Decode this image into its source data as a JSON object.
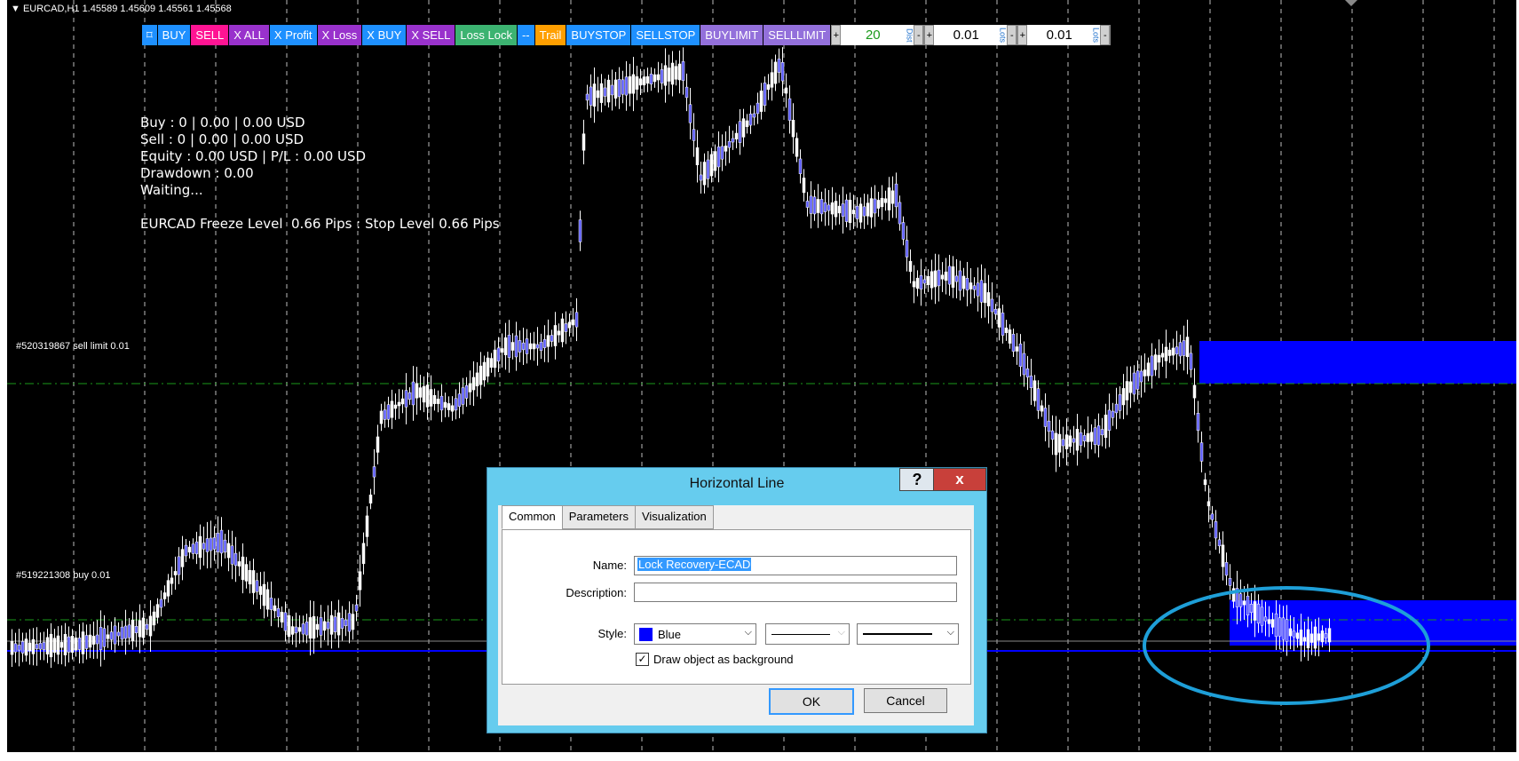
{
  "chart": {
    "header": "▼ EURCAD,H1  1.45589 1.45609 1.45561 1.45568",
    "sell_order_label": "#520319867 sell limit 0.01",
    "buy_order_label": "#519221308 buy 0.01"
  },
  "toolbar": {
    "buttons": [
      "⌑",
      "BUY",
      "SELL",
      "X ALL",
      "X Profit",
      "X Loss",
      "X BUY",
      "X SELL",
      "Loss Lock",
      "--",
      "Trail",
      "BUYSTOP",
      "SELLSTOP",
      "BUYLIMIT",
      "SELLLIMIT"
    ],
    "dist_value": "20",
    "dist_tag": "Dist",
    "lots_value_1": "0.01",
    "lots_tag_1": "Lots",
    "lots_value_2": "0.01",
    "lots_tag_2": "Lots",
    "plus": "+",
    "minus": "-"
  },
  "info": {
    "buy": "Buy : 0 | 0.00 | 0.00 USD",
    "sell": "Sell : 0 | 0.00 | 0.00 USD",
    "equity": "Equity : 0.00 USD | P/L : 0.00 USD",
    "drawdown": "Drawdown : 0.00",
    "status": "Waiting...",
    "levels": "EURCAD Freeze Level  0.66 Pips : Stop Level 0.66 Pips"
  },
  "dialog": {
    "title": "Horizontal Line",
    "help": "?",
    "close": "x",
    "tabs": [
      "Common",
      "Parameters",
      "Visualization"
    ],
    "name_label": "Name:",
    "name_value": "Lock Recovery-ECAD",
    "description_label": "Description:",
    "description_value": "",
    "style_label": "Style:",
    "color_value": "Blue",
    "draw_background_label": "Draw object as background",
    "draw_background_checked": true,
    "ok": "OK",
    "cancel": "Cancel"
  },
  "colors": {
    "chart_bg": "#000000",
    "candle": "#ffffff",
    "candle_down": "#5a5aff",
    "zone": "#0000ff",
    "dashed_order": "#1a9a1a",
    "highlight_circle": "#1e9fd8"
  }
}
